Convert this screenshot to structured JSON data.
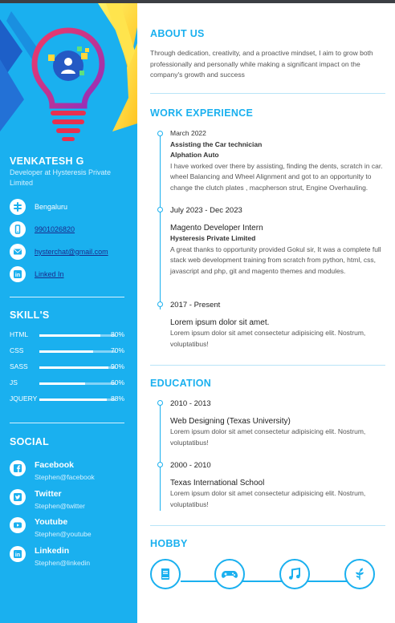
{
  "profile": {
    "name": "VENKATESH G",
    "role": "Developer at Hysteresis Private Limited"
  },
  "contacts": [
    {
      "icon": "location-icon",
      "value": "Bengaluru"
    },
    {
      "icon": "phone-icon",
      "value": "9901026820"
    },
    {
      "icon": "email-icon",
      "value": "hysterchat@gmail.com"
    },
    {
      "icon": "linkedin-icon",
      "value": "Linked In"
    }
  ],
  "skills": {
    "heading": "SKILL'S",
    "items": [
      {
        "name": "HTML",
        "percent": 80,
        "label": "80%"
      },
      {
        "name": "CSS",
        "percent": 70,
        "label": "70%"
      },
      {
        "name": "SASS",
        "percent": 90,
        "label": "90%"
      },
      {
        "name": "JS",
        "percent": 60,
        "label": "60%"
      },
      {
        "name": "JQUERY",
        "percent": 88,
        "label": "88%"
      }
    ]
  },
  "social": {
    "heading": "SOCIAL",
    "items": [
      {
        "icon": "facebook-icon",
        "name": "Facebook",
        "handle": "Stephen@facebook"
      },
      {
        "icon": "twitter-icon",
        "name": "Twitter",
        "handle": "Stephen@twitter"
      },
      {
        "icon": "youtube-icon",
        "name": "Youtube",
        "handle": "Stephen@youtube"
      },
      {
        "icon": "linkedin-icon",
        "name": "Linkedin",
        "handle": "Stephen@linkedin"
      }
    ]
  },
  "about": {
    "heading": "ABOUT US",
    "text": "Through dedication, creativity, and a proactive mindset, I aim to grow both professionally and personally while making a significant impact on the company's growth and success"
  },
  "work": {
    "heading": "WORK EXPERIENCE",
    "items": [
      {
        "date": "March 2022",
        "title": "Assisting the Car technician",
        "org": "Alphation Auto",
        "desc": "I have worked over there by assisting, finding the dents, scratch in car. wheel Balancing and Wheel Alignment and got to an opportunity to change the clutch plates , macpherson strut, Engine Overhauling."
      },
      {
        "date": "July 2023 - Dec 2023",
        "title": "Magento Developer Intern",
        "org": "Hysteresis Private Limited",
        "desc": "A great thanks to opportunity provided Gokul sir, It was a complete full stack web development training from scratch from python, html, css, javascript and php, git and magento themes and modules."
      },
      {
        "date": "2017 - Present",
        "title": "Lorem ipsum dolor sit amet.",
        "desc": "Lorem ipsum dolor sit amet consectetur adipisicing elit. Nostrum, voluptatibus!"
      }
    ]
  },
  "education": {
    "heading": "EDUCATION",
    "items": [
      {
        "date": "2010 - 2013",
        "title": "Web Designing (Texas University)",
        "desc": "Lorem ipsum dolor sit amet consectetur adipisicing elit. Nostrum, voluptatibus!"
      },
      {
        "date": "2000 - 2010",
        "title": "Texas International School",
        "desc": "Lorem ipsum dolor sit amet consectetur adipisicing elit. Nostrum, voluptatibus!"
      }
    ]
  },
  "hobby": {
    "heading": "HOBBY",
    "icons": [
      "book-icon",
      "gamepad-icon",
      "music-icon",
      "plant-icon"
    ]
  },
  "colors": {
    "accent": "#1ab0ef",
    "sidebar": "#1ab0ef",
    "link": "#1a2b8c",
    "bulb_red": "#e8304f",
    "hero_yellow": "#ffd83a"
  }
}
